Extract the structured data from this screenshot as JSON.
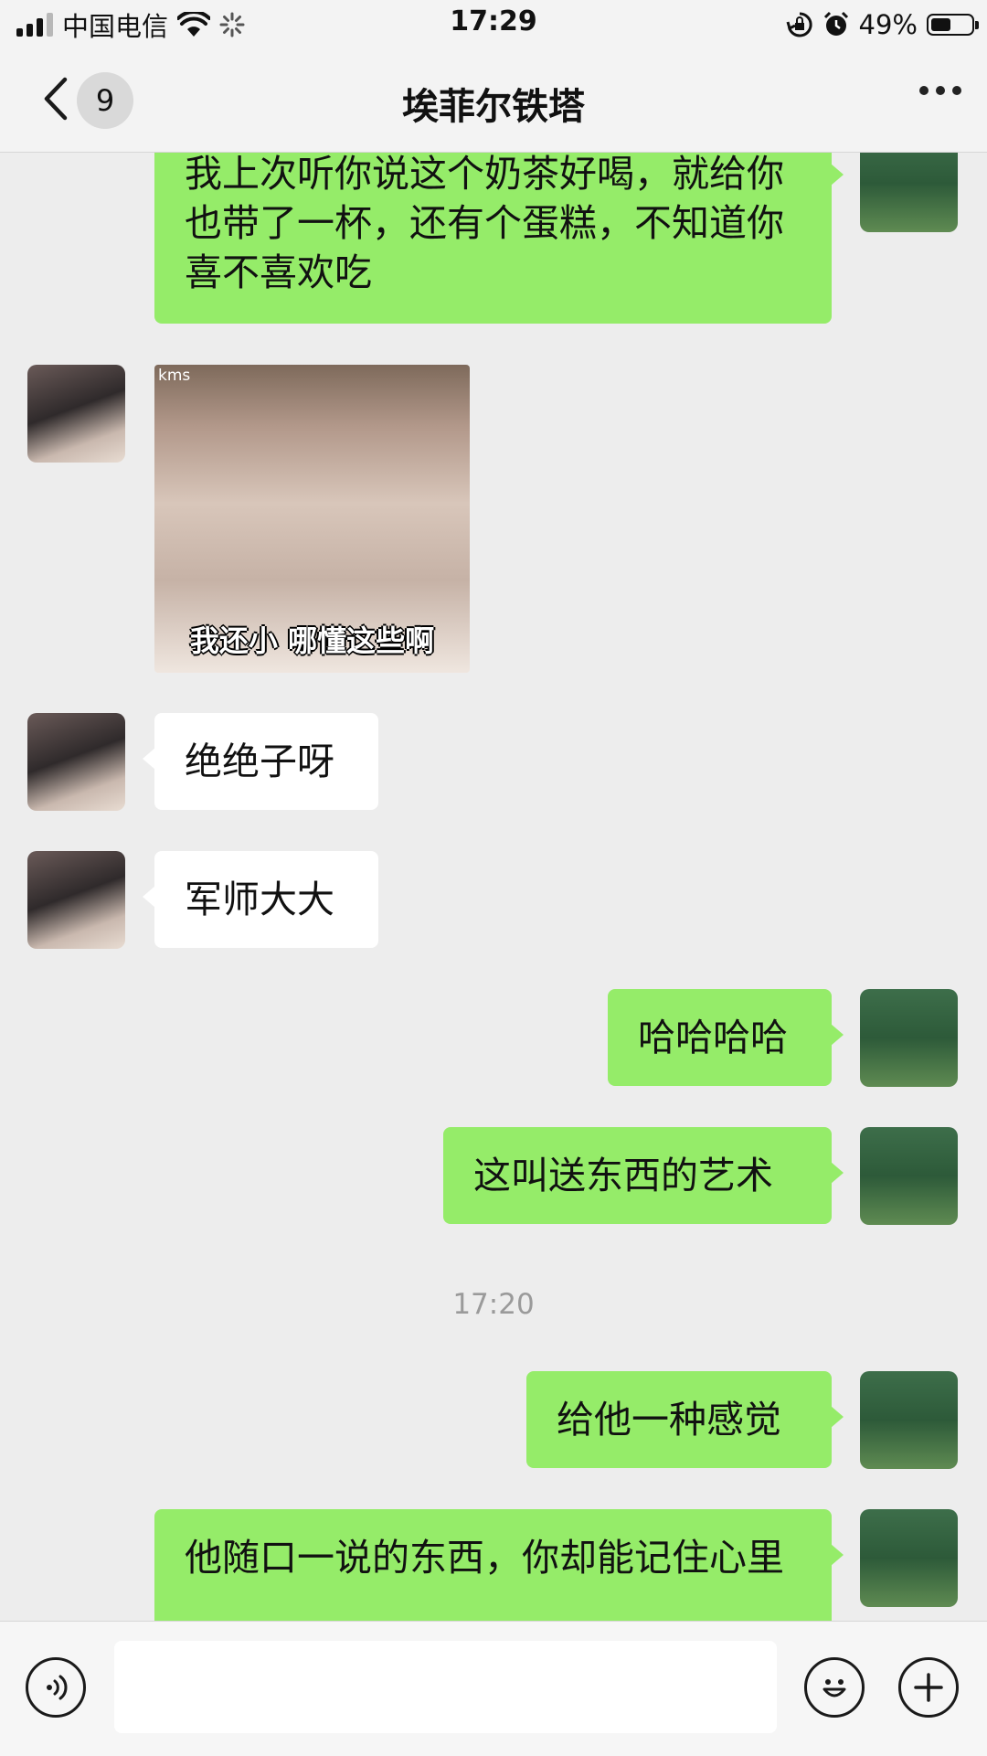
{
  "status_bar": {
    "carrier": "中国电信",
    "time": "17:29",
    "battery": "49%",
    "battery_level": 0.49,
    "icons": [
      "signal-icon",
      "wifi-icon",
      "loading-icon",
      "rotation-lock-icon",
      "alarm-icon",
      "battery-icon"
    ]
  },
  "header": {
    "back_icon": "chevron-left-icon",
    "unread_count": "9",
    "title": "埃菲尔铁塔",
    "more_icon": "more-icon"
  },
  "messages": [
    {
      "from": "self",
      "type": "text",
      "text": "我上次听你说这个奶茶好喝，就给你也带了一杯，还有个蛋糕，不知道你喜不喜欢吃"
    },
    {
      "from": "other",
      "type": "sticker",
      "caption": "我还小  哪懂这些啊",
      "tag": "kms"
    },
    {
      "from": "other",
      "type": "text",
      "text": "绝绝子呀"
    },
    {
      "from": "other",
      "type": "text",
      "text": "军师大大"
    },
    {
      "from": "self",
      "type": "text",
      "text": "哈哈哈哈"
    },
    {
      "from": "self",
      "type": "text",
      "text": "这叫送东西的艺术"
    },
    {
      "type": "timestamp",
      "text": "17:20"
    },
    {
      "from": "self",
      "type": "text",
      "text": "给他一种感觉"
    },
    {
      "from": "self",
      "type": "text",
      "text": "他随口一说的东西，你却能记住心里"
    }
  ],
  "input_bar": {
    "voice_icon": "voice-icon",
    "emoji_icon": "emoji-icon",
    "plus_icon": "plus-icon",
    "text": ""
  }
}
